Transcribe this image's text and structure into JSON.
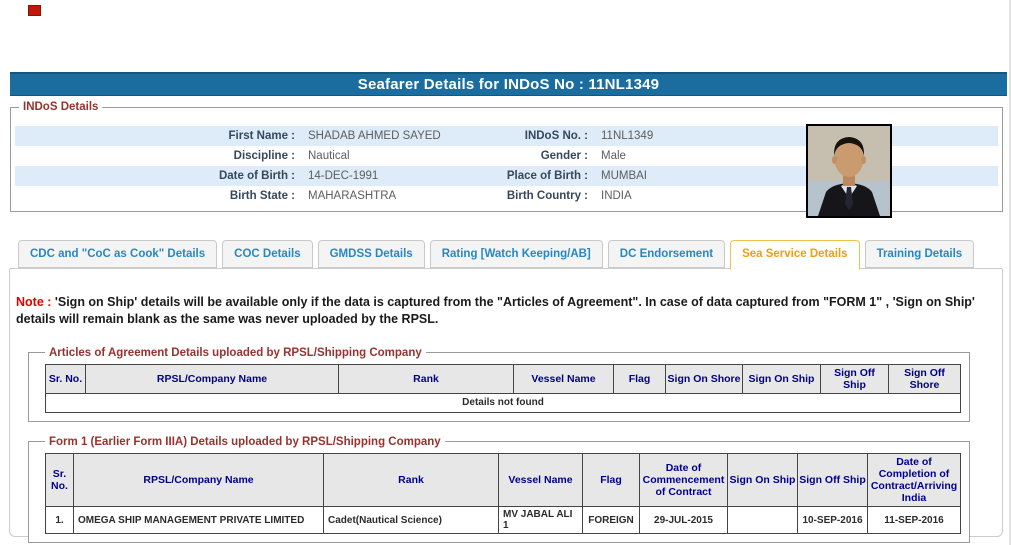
{
  "page": {
    "title_bar": "Seafarer Details for INDoS No : 11NL1349"
  },
  "indos": {
    "legend": "INDoS Details",
    "rows": [
      {
        "label1": "First Name :",
        "value1": "SHADAB AHMED SAYED",
        "label2": "INDoS No. :",
        "value2": "11NL1349"
      },
      {
        "label1": "Discipline :",
        "value1": "Nautical",
        "label2": "Gender :",
        "value2": "Male"
      },
      {
        "label1": "Date of Birth :",
        "value1": "14-DEC-1991",
        "label2": "Place of Birth :",
        "value2": "MUMBAI"
      },
      {
        "label1": "Birth State :",
        "value1": "MAHARASHTRA",
        "label2": "Birth Country :",
        "value2": "INDIA"
      }
    ],
    "photo": "seafarer-photo"
  },
  "tabs": [
    {
      "label": "CDC and \"CoC as Cook\" Details",
      "active": false
    },
    {
      "label": "COC Details",
      "active": false
    },
    {
      "label": "GMDSS Details",
      "active": false
    },
    {
      "label": "Rating [Watch Keeping/AB]",
      "active": false
    },
    {
      "label": "DC Endorsement",
      "active": false
    },
    {
      "label": "Sea Service Details",
      "active": true
    },
    {
      "label": "Training Details",
      "active": false
    }
  ],
  "note": {
    "prefix": "Note :",
    "text": " 'Sign on Ship' details will be available only if the data is captured from the \"Articles of Agreement\". In case of data captured from \"FORM 1\" , 'Sign on Ship' details will remain blank as the same was never uploaded by the RPSL."
  },
  "articles": {
    "legend": "Articles of Agreement Details uploaded by RPSL/Shipping Company",
    "columns": [
      "Sr. No.",
      "RPSL/Company Name",
      "Rank",
      "Vessel Name",
      "Flag",
      "Sign On Shore",
      "Sign On Ship",
      "Sign Off Ship",
      "Sign Off Shore"
    ],
    "empty_message": "Details not found"
  },
  "form1": {
    "legend": "Form 1 (Earlier Form IIIA) Details uploaded by RPSL/Shipping Company",
    "columns": [
      "Sr. No.",
      "RPSL/Company Name",
      "Rank",
      "Vessel Name",
      "Flag",
      "Date of Commencement of Contract",
      "Sign On Ship",
      "Sign Off Ship",
      "Date of Completion of Contract/Arriving India"
    ],
    "rows": [
      [
        "1.",
        "OMEGA SHIP MANAGEMENT PRIVATE LIMITED",
        "Cadet(Nautical Science)",
        "MV JABAL ALI 1",
        "FOREIGN",
        "29-JUL-2015",
        "",
        "10-SEP-2016",
        "11-SEP-2016"
      ]
    ]
  },
  "colors": {
    "titlebar_blue": "#1a6d9e",
    "tab_text_blue": "#2787c5",
    "active_tab_orange": "#f39c12",
    "legend_maroon": "#99322e",
    "table_header_navy": "#00008b",
    "note_red": "#e60000",
    "stripe_blue": "#ddecf8",
    "error_red": "#cc0000"
  }
}
